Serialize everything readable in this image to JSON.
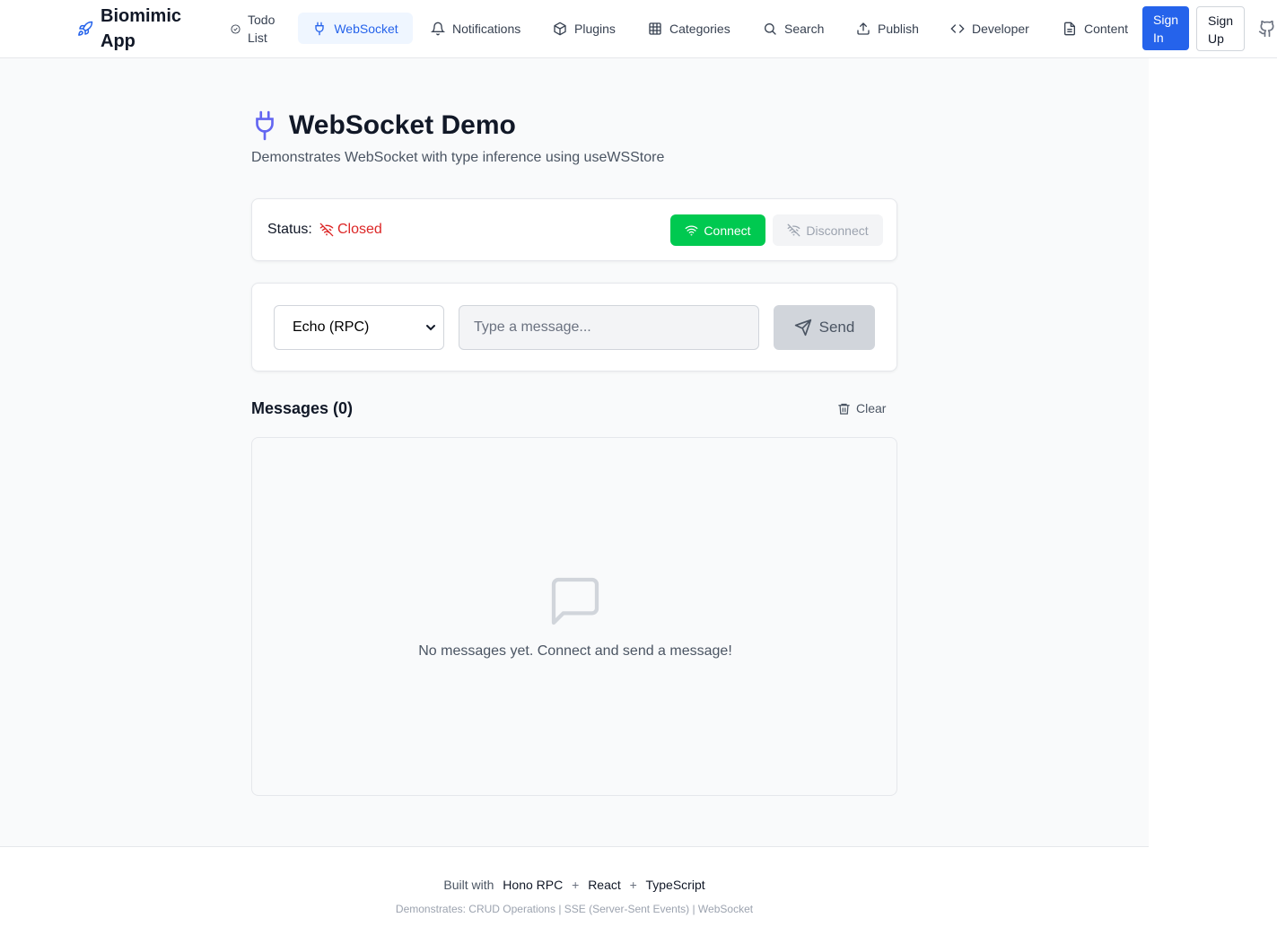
{
  "header": {
    "brand": "Biomimic App",
    "nav": [
      {
        "label": "Todo List",
        "icon": "check-circle-icon"
      },
      {
        "label": "WebSocket",
        "icon": "plug-icon",
        "active": true
      },
      {
        "label": "Notifications",
        "icon": "bell-icon"
      },
      {
        "label": "Plugins",
        "icon": "package-icon"
      },
      {
        "label": "Categories",
        "icon": "grid-icon"
      },
      {
        "label": "Search",
        "icon": "search-icon"
      },
      {
        "label": "Publish",
        "icon": "upload-icon"
      },
      {
        "label": "Developer",
        "icon": "code-icon"
      },
      {
        "label": "Content",
        "icon": "file-text-icon"
      }
    ],
    "sign_in": "Sign In",
    "sign_up": "Sign Up"
  },
  "page": {
    "title": "WebSocket Demo",
    "subtitle": "Demonstrates WebSocket with type inference using useWSStore"
  },
  "status": {
    "label": "Status:",
    "value": "Closed",
    "connect": "Connect",
    "disconnect": "Disconnect"
  },
  "composer": {
    "mode_selected": "Echo (RPC)",
    "placeholder": "Type a message...",
    "send": "Send"
  },
  "messages": {
    "heading": "Messages (0)",
    "clear": "Clear",
    "empty_text": "No messages yet. Connect and send a message!"
  },
  "footer": {
    "built_with": "Built with",
    "tech": [
      "Hono RPC",
      "React",
      "TypeScript"
    ],
    "separator": "+",
    "demonstrates": "Demonstrates: CRUD Operations | SSE (Server-Sent Events) | WebSocket"
  },
  "colors": {
    "accent": "#2563eb",
    "connect_green": "#00c950",
    "closed_red": "#dc2626",
    "title_icon": "#6366f1"
  }
}
